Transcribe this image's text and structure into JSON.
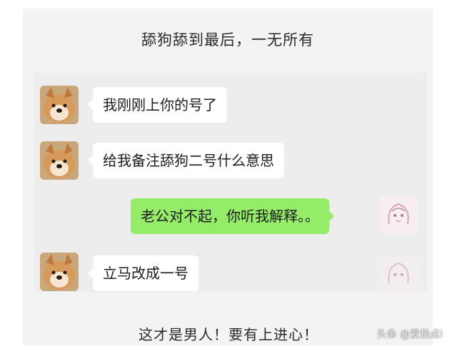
{
  "header": {
    "title": "舔狗舔到最后，一无所有"
  },
  "messages": [
    {
      "side": "left",
      "text": "我刚刚上你的号了",
      "avatar": "shiba-avatar"
    },
    {
      "side": "left",
      "text": "给我备注舔狗二号什么意思",
      "avatar": "shiba-avatar"
    },
    {
      "side": "right",
      "text": "老公对不起，你听我解释。。",
      "avatar": "anime-girl-avatar"
    },
    {
      "side": "left",
      "text": "立马改成一号",
      "avatar": "shiba-avatar"
    }
  ],
  "footer": {
    "caption": "这才是男人！要有上进心！"
  },
  "watermark": {
    "text": "头条 @爱热点i"
  },
  "colors": {
    "card_bg": "#f3f3f3",
    "chat_bg": "#ededed",
    "bubble_left": "#ffffff",
    "bubble_right": "#95ec69"
  }
}
